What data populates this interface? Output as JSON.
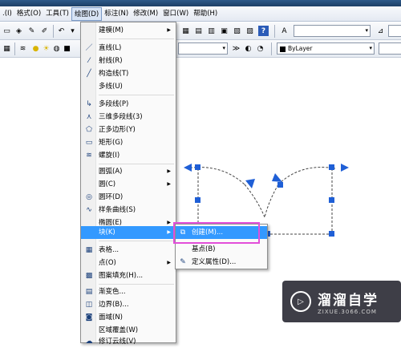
{
  "menubar": {
    "items": [
      {
        "label": ".(I)"
      },
      {
        "label": "格式(O)"
      },
      {
        "label": "工具(T)"
      },
      {
        "label": "绘图(D)"
      },
      {
        "label": "标注(N)"
      },
      {
        "label": "修改(M)"
      },
      {
        "label": "窗口(W)"
      },
      {
        "label": "帮助(H)"
      }
    ]
  },
  "toolbar": {
    "layer_combo": "ByLayer",
    "layer_combo_arrow": "▾",
    "style_combo_arrow": "▾"
  },
  "draw_menu": {
    "items": [
      {
        "label": "建模(M)",
        "icon": "",
        "submenu": true
      },
      {
        "label": "直线(L)",
        "icon": "line-icon"
      },
      {
        "label": "射线(R)",
        "icon": "ray-icon"
      },
      {
        "label": "构造线(T)",
        "icon": "construction-line-icon"
      },
      {
        "label": "多线(U)",
        "icon": ""
      },
      {
        "label": "多段线(P)",
        "icon": "polyline-icon"
      },
      {
        "label": "三维多段线(3)",
        "icon": "3d-polyline-icon"
      },
      {
        "label": "正多边形(Y)",
        "icon": "polygon-icon"
      },
      {
        "label": "矩形(G)",
        "icon": "rectangle-icon"
      },
      {
        "label": "螺旋(I)",
        "icon": "helix-icon"
      },
      {
        "label": "圆弧(A)",
        "icon": "",
        "submenu": true
      },
      {
        "label": "圆(C)",
        "icon": "",
        "submenu": true
      },
      {
        "label": "圆环(D)",
        "icon": "donut-icon"
      },
      {
        "label": "样条曲线(S)",
        "icon": "spline-icon"
      },
      {
        "label": "椭圆(E)",
        "icon": "",
        "submenu": true
      },
      {
        "label": "块(K)",
        "icon": "",
        "submenu": true,
        "highlighted": true
      },
      {
        "label": "表格...",
        "icon": "table-icon"
      },
      {
        "label": "点(O)",
        "icon": "",
        "submenu": true
      },
      {
        "label": "图案填充(H)...",
        "icon": "hatch-icon"
      },
      {
        "label": "渐变色...",
        "icon": "gradient-icon"
      },
      {
        "label": "边界(B)...",
        "icon": "boundary-icon"
      },
      {
        "label": "面域(N)",
        "icon": "region-icon"
      },
      {
        "label": "区域覆盖(W)",
        "icon": ""
      },
      {
        "label": "修订云线(V)",
        "icon": "revcloud-icon"
      }
    ],
    "submenu_arrow": "▶"
  },
  "block_menu": {
    "items": [
      {
        "label": "创建(M)...",
        "icon": "create-block-icon",
        "highlighted": true
      },
      {
        "label": "基点(B)",
        "icon": ""
      },
      {
        "label": "定义属性(D)...",
        "icon": "define-attribute-icon"
      }
    ]
  },
  "watermark": {
    "title": "溜溜自学",
    "url": "ZIXUE.3066.COM",
    "logo_glyph": "▷"
  },
  "colors": {
    "menu_highlight": "#3399ff",
    "callout_border": "#e24ed9",
    "grip_blue": "#1f5fd6"
  }
}
